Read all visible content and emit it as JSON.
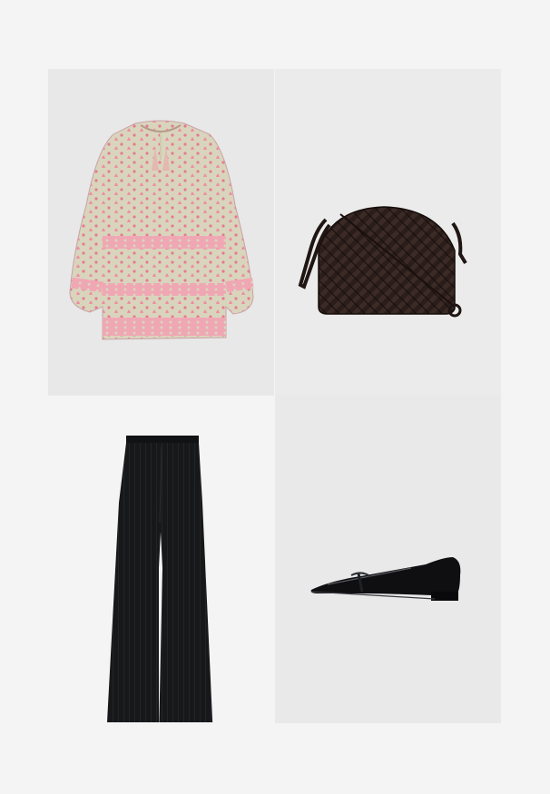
{
  "outfit": {
    "items": [
      {
        "kind": "blouse",
        "color": "#e98ea0",
        "accent": "#d6d2b8"
      },
      {
        "kind": "bag",
        "color": "#2a1d1a"
      },
      {
        "kind": "trousers",
        "color": "#17181a"
      },
      {
        "kind": "shoe",
        "color": "#0f0f12"
      }
    ]
  }
}
